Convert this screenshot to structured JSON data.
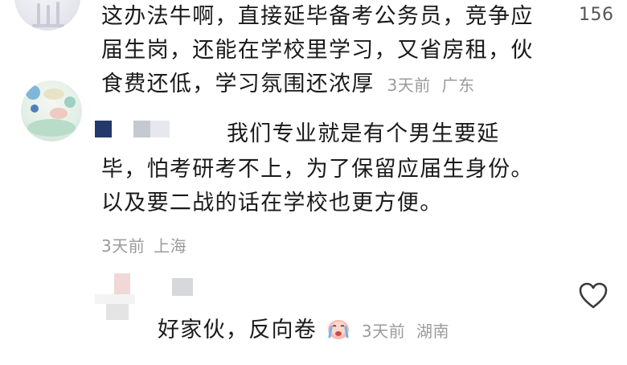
{
  "comments": [
    {
      "lines": [
        "这办法牛啊，直接延毕备考公务员，竞争应",
        "届生岗，还能在学校里学习，又省房租，伙",
        "食费还低，学习氛围还浓厚"
      ],
      "time": "3天前",
      "location": "广东",
      "like_count": "156"
    },
    {
      "lines": [
        "我们专业就是有个男生要延",
        "毕，怕考研考不上，为了保留应届生身份。",
        "以及要二战的话在学校也更方便。"
      ],
      "time": "3天前",
      "location": "上海"
    },
    {
      "text": "好家伙，反向卷",
      "emoji": "crying-face-icon",
      "time": "3天前",
      "location": "湖南"
    }
  ],
  "icons": {
    "like": "heart-outline-icon"
  },
  "colors": {
    "text": "#1a1a1a",
    "meta": "#9b9b9b",
    "name_block_dark": "#23396b",
    "name_block_gray": "#c6c9d2"
  }
}
